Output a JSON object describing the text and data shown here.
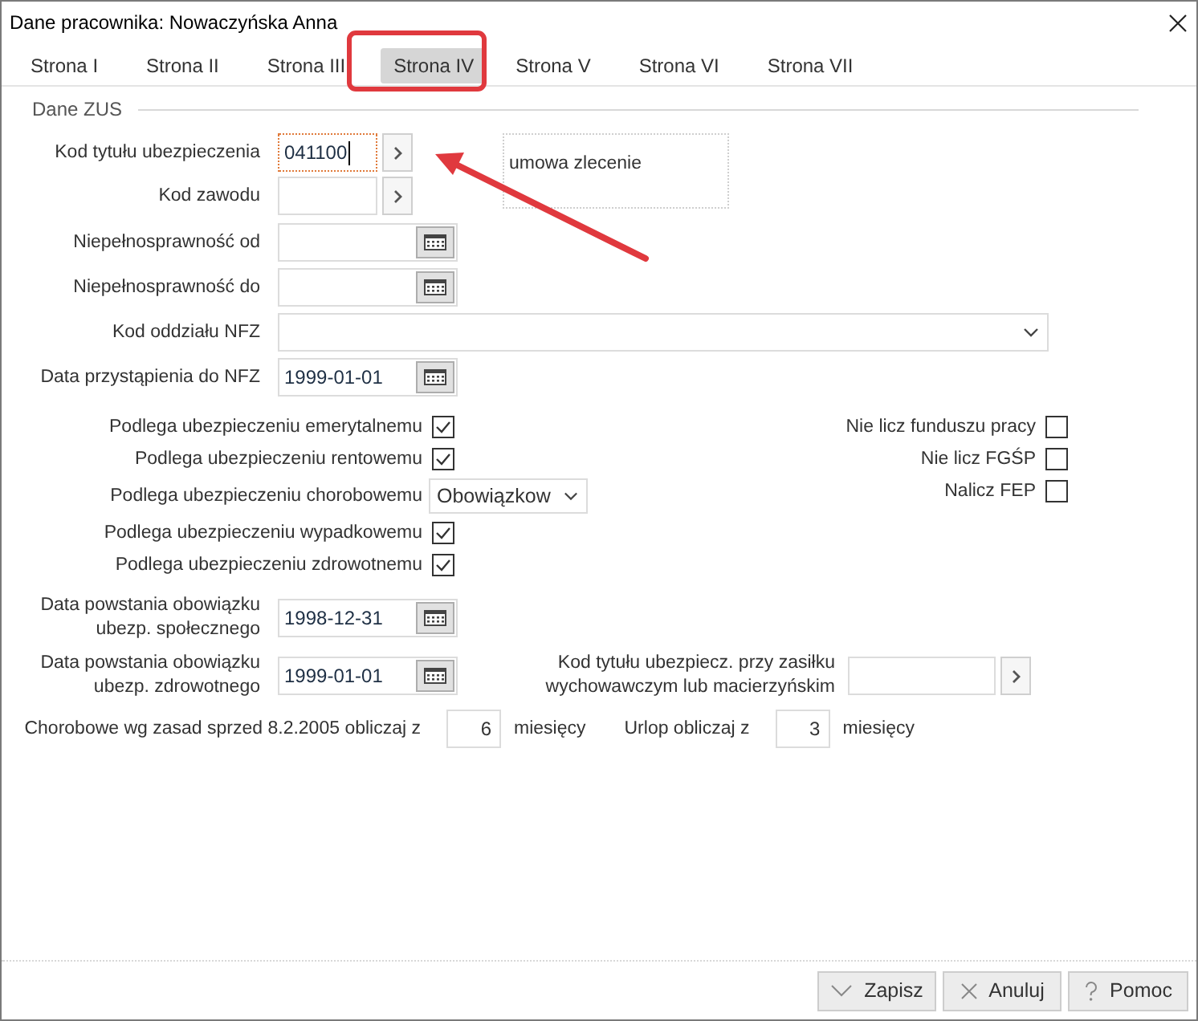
{
  "window": {
    "title": "Dane pracownika: Nowaczyńska Anna"
  },
  "tabs": [
    {
      "label": "Strona I",
      "selected": false
    },
    {
      "label": "Strona II",
      "selected": false
    },
    {
      "label": "Strona III",
      "selected": false
    },
    {
      "label": "Strona IV",
      "selected": true
    },
    {
      "label": "Strona V",
      "selected": false
    },
    {
      "label": "Strona VI",
      "selected": false
    },
    {
      "label": "Strona VII",
      "selected": false
    }
  ],
  "group": {
    "title": "Dane ZUS"
  },
  "insurance_title_code": {
    "label": "Kod tytułu ubezpieczenia",
    "value": "041100",
    "focused": true,
    "description": "umowa zlecenie"
  },
  "occupation_code": {
    "label": "Kod zawodu"
  },
  "disability_from": {
    "label": "Niepełnosprawność od"
  },
  "disability_to": {
    "label": "Niepełnosprawność do"
  },
  "nfz_branch": {
    "label": "Kod oddziału NFZ"
  },
  "nfz_join_date": {
    "label": "Data przystąpienia do NFZ",
    "value": "1999-01-01"
  },
  "insurance_checks": [
    {
      "kind": "checkbox",
      "label": "Podlega ubezpieczeniu emerytalnemu",
      "checked": true
    },
    {
      "kind": "checkbox",
      "label": "Podlega ubezpieczeniu rentowemu",
      "checked": true
    },
    {
      "kind": "select",
      "label": "Podlega ubezpieczeniu chorobowemu",
      "value": "Obowiązkow"
    },
    {
      "kind": "checkbox",
      "label": "Podlega ubezpieczeniu wypadkowemu",
      "checked": true
    },
    {
      "kind": "checkbox",
      "label": "Podlega ubezpieczeniu zdrowotnemu",
      "checked": true
    }
  ],
  "fund_checks": [
    {
      "label": "Nie licz funduszu pracy",
      "checked": false
    },
    {
      "label": "Nie licz FGŚP",
      "checked": false
    },
    {
      "label": "Nalicz FEP",
      "checked": false
    }
  ],
  "social_obligation_date": {
    "label": "Data powstania obowiązku\nubezp. społecznego",
    "value": "1998-12-31"
  },
  "health_obligation_date": {
    "label": "Data powstania obowiązku\nubezp. zdrowotnego",
    "value": "1999-01-01"
  },
  "benefit_title_code": {
    "label": "Kod tytułu ubezpiecz. przy zasiłku\nwychowawczym lub macierzyńskim"
  },
  "sickness": {
    "label": "Chorobowe wg zasad sprzed 8.2.2005 obliczaj z",
    "value": "6",
    "unit": "miesięcy"
  },
  "leave": {
    "label": "Urlop obliczaj z",
    "value": "3",
    "unit": "miesięcy"
  },
  "buttons": [
    {
      "kind": "save",
      "label": "Zapisz"
    },
    {
      "kind": "cancel",
      "label": "Anuluj"
    },
    {
      "kind": "help",
      "label": "Pomoc"
    }
  ]
}
